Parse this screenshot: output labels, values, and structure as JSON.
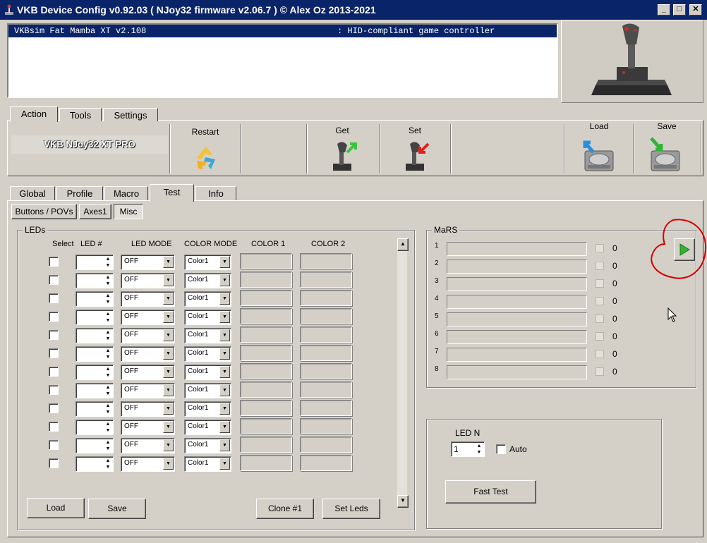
{
  "window": {
    "title": "VKB Device Config v0.92.03 ( NJoy32 firmware v2.06.7 ) © Alex Oz 2013-2021"
  },
  "device_list": {
    "rows": [
      {
        "name": "VKBsim Fat Mamba XT v2.108",
        "type": ": HID-compliant game controller"
      }
    ]
  },
  "main_tabs": [
    "Action",
    "Tools",
    "Settings"
  ],
  "action_bar": {
    "device_label": "VKB NJoy32 XT PRO",
    "restart": "Restart",
    "get": "Get",
    "set": "Set",
    "load": "Load",
    "save": "Save"
  },
  "sub_tabs": [
    "Global",
    "Profile",
    "Macro",
    "Test",
    "Info"
  ],
  "test_tabs": [
    "Buttons / POVs",
    "Axes1",
    "Misc"
  ],
  "leds": {
    "group_label": "LEDs",
    "headers": {
      "select": "Select",
      "led_num": "LED #",
      "led_mode": "LED MODE",
      "color_mode": "COLOR MODE",
      "color1": "COLOR 1",
      "color2": "COLOR 2"
    },
    "rows": [
      {
        "led_num": "",
        "mode": "OFF",
        "color_mode": "Color1"
      },
      {
        "led_num": "",
        "mode": "OFF",
        "color_mode": "Color1"
      },
      {
        "led_num": "",
        "mode": "OFF",
        "color_mode": "Color1"
      },
      {
        "led_num": "",
        "mode": "OFF",
        "color_mode": "Color1"
      },
      {
        "led_num": "",
        "mode": "OFF",
        "color_mode": "Color1"
      },
      {
        "led_num": "",
        "mode": "OFF",
        "color_mode": "Color1"
      },
      {
        "led_num": "",
        "mode": "OFF",
        "color_mode": "Color1"
      },
      {
        "led_num": "",
        "mode": "OFF",
        "color_mode": "Color1"
      },
      {
        "led_num": "",
        "mode": "OFF",
        "color_mode": "Color1"
      },
      {
        "led_num": "",
        "mode": "OFF",
        "color_mode": "Color1"
      },
      {
        "led_num": "",
        "mode": "OFF",
        "color_mode": "Color1"
      },
      {
        "led_num": "",
        "mode": "OFF",
        "color_mode": "Color1"
      }
    ],
    "buttons": {
      "load": "Load",
      "save": "Save",
      "clone": "Clone #1",
      "set_leds": "Set Leds"
    }
  },
  "mars": {
    "group_label": "MaRS",
    "rows": [
      {
        "index": "1",
        "value": "0",
        "level": 0
      },
      {
        "index": "2",
        "value": "0",
        "level": 0
      },
      {
        "index": "3",
        "value": "0",
        "level": 0
      },
      {
        "index": "4",
        "value": "0",
        "level": 0
      },
      {
        "index": "5",
        "value": "0",
        "level": 0
      },
      {
        "index": "6",
        "value": "0",
        "level": 0
      },
      {
        "index": "7",
        "value": "0",
        "level": 0
      },
      {
        "index": "8",
        "value": "0",
        "level": 0
      }
    ],
    "play_icon": "play-icon"
  },
  "led_test": {
    "led_n_label": "LED N",
    "led_n_value": "1",
    "auto_label": "Auto",
    "fast_test": "Fast Test"
  },
  "colors": {
    "titlebar": "#0a246a",
    "annotation": "#d40000",
    "play": "#34b233",
    "face": "#d4d0c8"
  }
}
